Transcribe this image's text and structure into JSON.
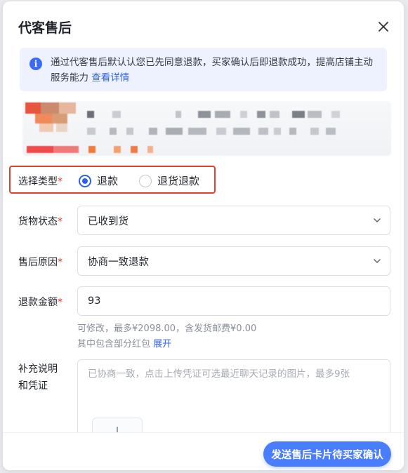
{
  "dialog": {
    "title": "代客售后"
  },
  "notice": {
    "text": "通过代客售后默认认您已先同意退款，买家确认后即退款成功，提高店铺主动服务能力",
    "link": "查看详情"
  },
  "form": {
    "type": {
      "label": "选择类型",
      "options": [
        {
          "label": "退款",
          "selected": true
        },
        {
          "label": "退货退款",
          "selected": false
        }
      ]
    },
    "goods_status": {
      "label": "货物状态",
      "value": "已收到货"
    },
    "reason": {
      "label": "售后原因",
      "value": "协商一致退款"
    },
    "amount": {
      "label": "退款金额",
      "value": "93",
      "hint1": "可修改，最多¥2098.00，含发货邮费¥0.00",
      "hint2": "其中包含部分红包",
      "expand": "展开"
    },
    "note": {
      "label_line1": "补充说明",
      "label_line2": "和凭证",
      "placeholder": "已协商一致，点击上传凭证可选最近聊天记录的图片，最多9张"
    },
    "required_mark": "*"
  },
  "footer": {
    "submit": "发送售后卡片待买家确认"
  },
  "colors": {
    "primary": "#4a7dfb",
    "link": "#2f62e8",
    "highlight": "#e0412f",
    "notice_bg": "#eef2ff"
  }
}
